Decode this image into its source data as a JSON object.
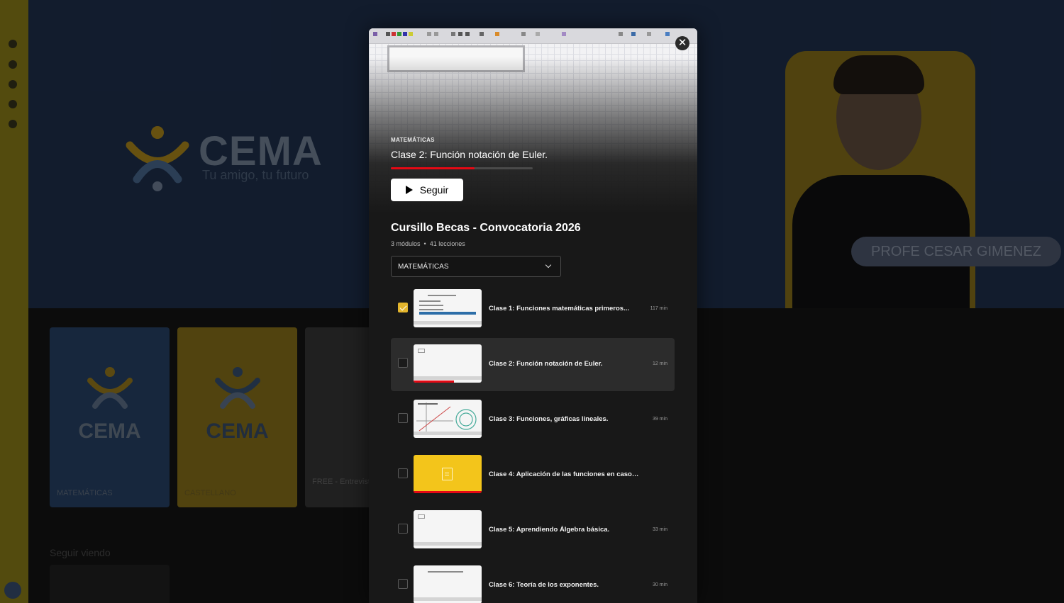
{
  "background": {
    "brand": {
      "name": "CEMA",
      "tagline": "Tu amigo, tu futuro",
      "colors": {
        "yellow": "#F5C518",
        "blue": "#1E3A5F"
      }
    },
    "teacher_pill": "PROFE CESAR GIMENEZ",
    "cards": [
      {
        "logo": "CEMA",
        "label": "MATEMÁTICAS",
        "bg": "#1f3552"
      },
      {
        "logo": "CEMA",
        "label": "CASTELLANO",
        "bg": "#6d5a15"
      },
      {
        "logo": "",
        "label": "FREE - Entrevista",
        "bg": "#2b2b2b"
      }
    ],
    "continue_heading": "Seguir viendo"
  },
  "modal": {
    "close_icon": "close-icon",
    "hero": {
      "subject": "MATEMÁTICAS",
      "title": "Clase 2: Función notación de Euler.",
      "progress": 0.59,
      "resume_label": "Seguir",
      "accent": "#e50914"
    },
    "course": {
      "title": "Cursillo Becas - Convocatoria 2026",
      "modules": "3 módulos",
      "separator": "•",
      "lessons_count": "41 lecciones"
    },
    "module_select": {
      "value": "MATEMÁTICAS"
    },
    "lessons": [
      {
        "title": "Clase 1: Funciones matemáticas primeros...",
        "duration": "117 min",
        "done": true,
        "active": false,
        "thumb": "slide",
        "progress": 0
      },
      {
        "title": "Clase 2: Función notación de Euler.",
        "duration": "12 min",
        "done": false,
        "active": true,
        "thumb": "blank",
        "progress": 0.59
      },
      {
        "title": "Clase 3: Funciones, gráficas lineales.",
        "duration": "39 min",
        "done": false,
        "active": false,
        "thumb": "graph",
        "progress": 0
      },
      {
        "title": "Clase 4: Aplicación de las funciones en casos de ...",
        "duration": "",
        "done": false,
        "active": false,
        "thumb": "document",
        "progress": 1
      },
      {
        "title": "Clase 5: Aprendiendo Álgebra básica.",
        "duration": "33 min",
        "done": false,
        "active": false,
        "thumb": "blank",
        "progress": 0
      },
      {
        "title": "Clase 6: Teoría de los exponentes.",
        "duration": "30 min",
        "done": false,
        "active": false,
        "thumb": "slide2",
        "progress": 0
      }
    ]
  }
}
